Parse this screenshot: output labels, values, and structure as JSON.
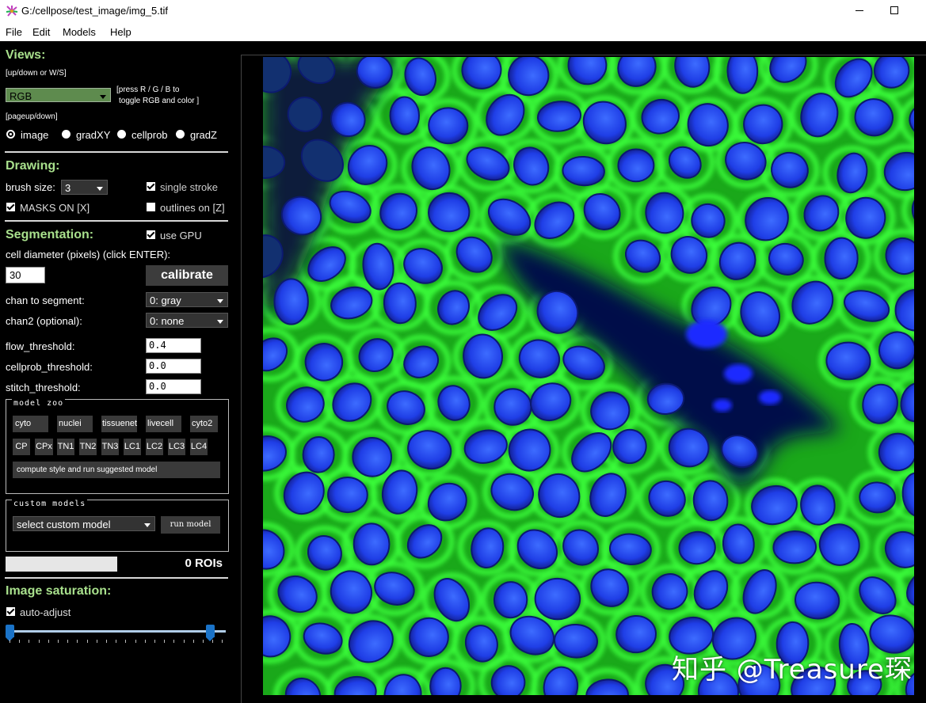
{
  "window": {
    "title": "G:/cellpose/test_image/img_5.tif"
  },
  "menu": [
    "File",
    "Edit",
    "Models",
    "Help"
  ],
  "views": {
    "heading": "Views:",
    "hint_updown": "[up/down or W/S]",
    "view_selected": "RGB",
    "hint_rgb_1": "[press R / G / B to",
    "hint_rgb_2": "toggle RGB and color ]",
    "hint_pageupdown": "[pageup/down]",
    "radios": [
      "image",
      "gradXY",
      "cellprob",
      "gradZ"
    ],
    "radio_selected": "image"
  },
  "drawing": {
    "heading": "Drawing:",
    "brush_label": "brush size:",
    "brush_value": "3",
    "single_stroke": "single stroke",
    "single_stroke_checked": true,
    "masks_on": "MASKS ON [X]",
    "masks_on_checked": true,
    "outlines_on": "outlines on [Z]",
    "outlines_on_checked": false
  },
  "segmentation": {
    "heading": "Segmentation:",
    "use_gpu": "use GPU",
    "use_gpu_checked": true,
    "diameter_label": "cell diameter (pixels) (click ENTER):",
    "diameter_value": "30",
    "calibrate": "calibrate",
    "chan_label": "chan to segment:",
    "chan_value": "0: gray",
    "chan2_label": "chan2 (optional):",
    "chan2_value": "0: none",
    "flow_label": "flow_threshold:",
    "flow_value": "0.4",
    "cellprob_label": "cellprob_threshold:",
    "cellprob_value": "0.0",
    "stitch_label": "stitch_threshold:",
    "stitch_value": "0.0"
  },
  "model_zoo": {
    "title": "model zoo",
    "row1": [
      "cyto",
      "nuclei",
      "tissuenet",
      "livecell",
      "cyto2"
    ],
    "row2": [
      "CP",
      "CPx",
      "TN1",
      "TN2",
      "TN3",
      "LC1",
      "LC2",
      "LC3",
      "LC4"
    ],
    "compute": "compute style and run suggested model"
  },
  "custom_models": {
    "title": "custom models",
    "select": "select custom model",
    "run": "run model"
  },
  "status": {
    "progress": 0,
    "rois": "0 ROIs"
  },
  "saturation": {
    "heading": "Image saturation:",
    "auto_adjust": "auto-adjust",
    "auto_adjust_checked": true,
    "low": 0.0,
    "high": 0.95
  },
  "watermark": "知乎 @Treasure琛",
  "colors": {
    "heading_green": "#a8e08c",
    "cell_membrane": "#1ee01e",
    "nucleus": "#1e3cff",
    "slider": "#1a73c8"
  }
}
